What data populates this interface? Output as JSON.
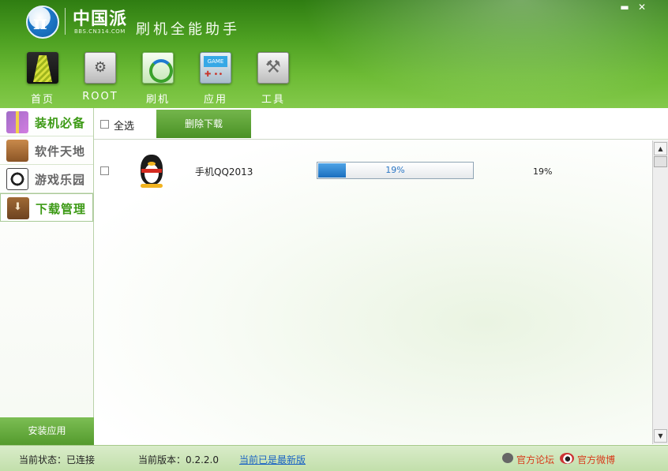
{
  "window": {
    "brand": "中国派",
    "brand_sub": "BBS.CN314.COM",
    "title": "刷机全能助手",
    "minimize": "▬",
    "close": "✕"
  },
  "nav": [
    {
      "label": "首页",
      "icon": "necktie-icon"
    },
    {
      "label": "ROOT",
      "icon": "safe-icon"
    },
    {
      "label": "刷机",
      "icon": "refresh-disc-icon"
    },
    {
      "label": "应用",
      "icon": "game-console-icon"
    },
    {
      "label": "工具",
      "icon": "tools-icon"
    }
  ],
  "sidebar": {
    "items": [
      {
        "label": "装机必备",
        "icon": "gift-icon",
        "active": true
      },
      {
        "label": "软件天地",
        "icon": "briefcase-icon",
        "active": false
      },
      {
        "label": "游戏乐园",
        "icon": "soccer-ball-icon",
        "active": false
      },
      {
        "label": "下载管理",
        "icon": "download-box-icon",
        "active": true
      }
    ],
    "install_button": "安装应用"
  },
  "toolbar": {
    "select_all": "全选",
    "delete_button": "删除下载"
  },
  "downloads": [
    {
      "name": "手机QQ2013",
      "icon": "qq-penguin-icon",
      "progress_percent": 19,
      "progress_label": "19%",
      "status": "19%",
      "checked": false
    }
  ],
  "statusbar": {
    "state": "当前状态：已连接",
    "version": "当前版本：0.2.2.0",
    "latest_link": "当前已是最新版",
    "forum_link": "官方论坛",
    "weibo_link": "官方微博"
  },
  "colors": {
    "header_green": "#4c9f21",
    "active_text": "#3d9a16",
    "progress_blue": "#1a6fbf",
    "link_blue": "#1a63c4",
    "link_red": "#d83c1c"
  }
}
